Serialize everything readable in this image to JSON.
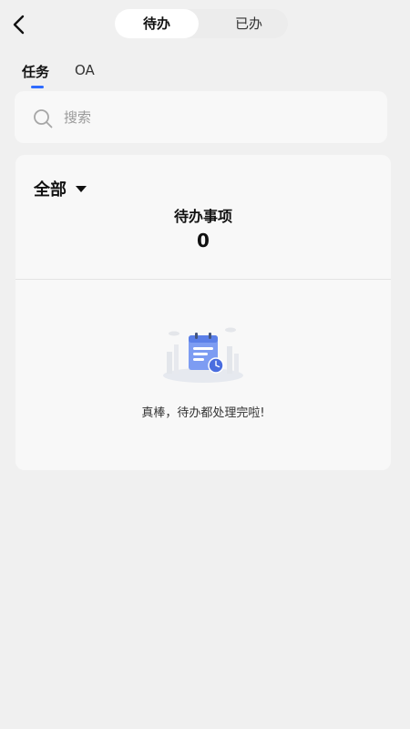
{
  "header": {
    "back_icon": "chevron-left-icon",
    "tabs": [
      {
        "label": "待办",
        "active": true
      },
      {
        "label": "已办",
        "active": false
      }
    ]
  },
  "subtabs": [
    {
      "label": "任务",
      "active": true
    },
    {
      "label": "OA",
      "active": false
    }
  ],
  "search": {
    "placeholder": "搜索",
    "value": "",
    "icon": "search-icon"
  },
  "card": {
    "filter_label": "全部",
    "filter_icon": "caret-down-icon",
    "pending_label": "待办事项",
    "pending_count": "0",
    "empty_text": "真棒，待办都处理完啦!",
    "empty_icon": "calendar-clock-icon"
  },
  "colors": {
    "accent": "#2f6bff",
    "background": "#f0f0f0",
    "card": "#f8f8f8"
  }
}
